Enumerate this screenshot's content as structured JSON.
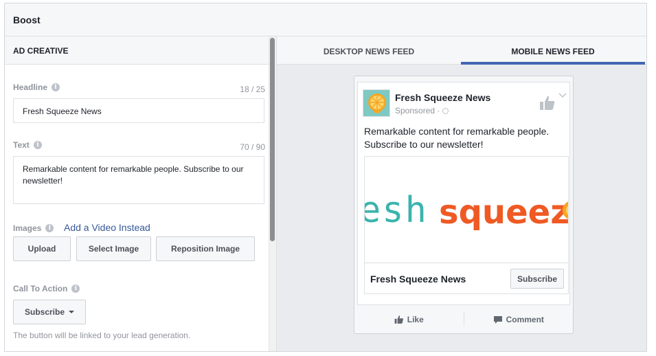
{
  "window": {
    "title": "Boost"
  },
  "left": {
    "header": "AD CREATIVE",
    "headline": {
      "label": "Headline",
      "counter": "18 / 25",
      "value": "Fresh Squeeze News"
    },
    "text": {
      "label": "Text",
      "counter": "70 / 90",
      "value": "Remarkable content for remarkable people. Subscribe to our newsletter!"
    },
    "images": {
      "label": "Images",
      "add_video": "Add a Video Instead",
      "upload": "Upload",
      "select": "Select Image",
      "reposition": "Reposition Image"
    },
    "cta": {
      "label": "Call To Action",
      "selected": "Subscribe",
      "helper": "The button will be linked to your lead generation."
    }
  },
  "right": {
    "tabs": [
      {
        "label": "DESKTOP NEWS FEED"
      },
      {
        "label": "MOBILE NEWS FEED"
      }
    ],
    "active_tab": 1,
    "preview": {
      "page_name": "Fresh Squeeze News",
      "sponsored": "Sponsored ·",
      "post_text": "Remarkable content for remarkable people. Subscribe to our newsletter!",
      "logo_left": "esh",
      "logo_right": "squeeze",
      "link_title": "Fresh Squeeze News",
      "cta_button": "Subscribe",
      "like": "Like",
      "comment": "Comment"
    }
  },
  "colors": {
    "accent": "#4267b2",
    "link": "#365899",
    "logo_teal": "#3bb3ad",
    "logo_orange": "#ef5a24"
  }
}
